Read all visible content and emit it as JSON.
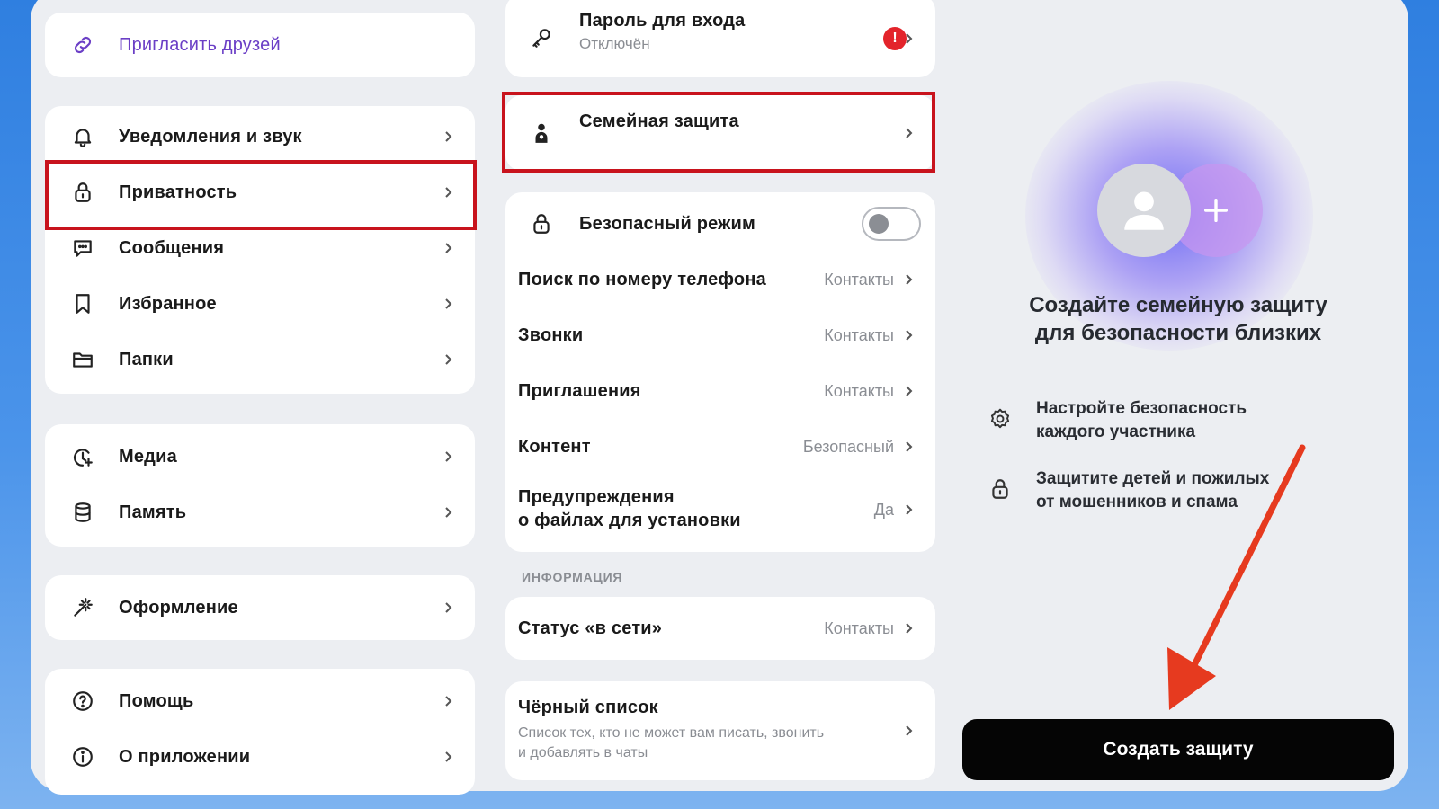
{
  "colors": {
    "accent_red": "#c8131d",
    "badge_red": "#e3242b",
    "cta_bg": "#050505",
    "invite_purple": "#6b3fc6"
  },
  "left_menu": {
    "invite": {
      "label": "Пригласить друзей",
      "icon": "link-icon"
    },
    "group1": [
      {
        "label": "Уведомления и звук",
        "icon": "bell-icon"
      },
      {
        "label": "Приватность",
        "icon": "lock-icon",
        "highlighted": true
      },
      {
        "label": "Сообщения",
        "icon": "chat-icon"
      },
      {
        "label": "Избранное",
        "icon": "bookmark-icon"
      },
      {
        "label": "Папки",
        "icon": "folder-icon"
      }
    ],
    "group2": [
      {
        "label": "Медиа",
        "icon": "media-icon"
      },
      {
        "label": "Память",
        "icon": "database-icon"
      }
    ],
    "group3": [
      {
        "label": "Оформление",
        "icon": "magic-wand-icon"
      }
    ],
    "group4": [
      {
        "label": "Помощь",
        "icon": "help-icon"
      },
      {
        "label": "О приложении",
        "icon": "info-icon"
      }
    ]
  },
  "privacy": {
    "password": {
      "label": "Пароль для входа",
      "status": "Отключён",
      "badge": "!"
    },
    "family": {
      "label": "Семейная защита"
    },
    "safe_mode": {
      "label": "Безопасный режим",
      "enabled": false
    },
    "settings": [
      {
        "label": "Поиск по номеру телефона",
        "value": "Контакты"
      },
      {
        "label": "Звонки",
        "value": "Контакты"
      },
      {
        "label": "Приглашения",
        "value": "Контакты"
      },
      {
        "label": "Контент",
        "value": "Безопасный"
      },
      {
        "label": "Предупреждения",
        "label2": "о файлах для установки",
        "value": "Да"
      }
    ],
    "info_header": "ИНФОРМАЦИЯ",
    "online_status": {
      "label": "Статус «в сети»",
      "value": "Контакты"
    },
    "blacklist": {
      "label": "Чёрный список",
      "desc1": "Список тех, кто не может вам писать, звонить",
      "desc2": "и добавлять в чаты"
    }
  },
  "promo": {
    "title_line1": "Создайте семейную защиту",
    "title_line2": "для безопасности близких",
    "features": [
      {
        "icon": "gear-icon",
        "line1": "Настройте безопасность",
        "line2": "каждого участника"
      },
      {
        "icon": "lock-icon",
        "line1": "Защитите детей и пожилых",
        "line2": "от мошенников и спама"
      }
    ],
    "button_label": "Создать защиту"
  }
}
